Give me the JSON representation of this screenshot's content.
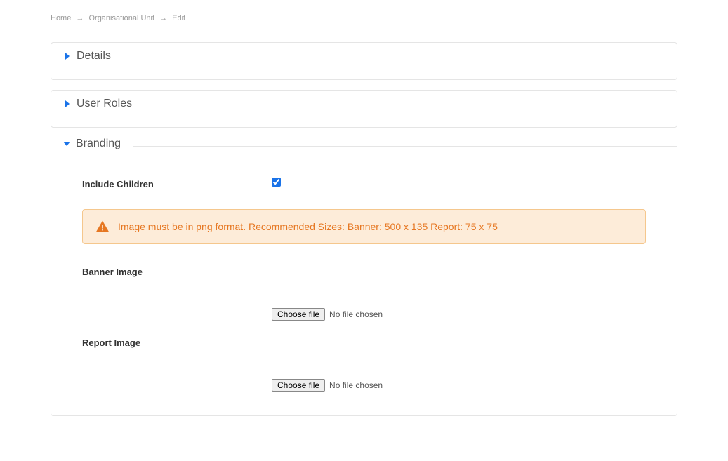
{
  "breadcrumb": {
    "items": [
      {
        "label": "Home"
      },
      {
        "label": "Organisational Unit"
      },
      {
        "label": "Edit"
      }
    ],
    "separator": "→"
  },
  "panels": {
    "details": {
      "title": "Details"
    },
    "userRoles": {
      "title": "User Roles"
    },
    "branding": {
      "title": "Branding"
    }
  },
  "branding": {
    "includeChildren": {
      "label": "Include Children",
      "checked": true
    },
    "alert": {
      "text": "Image must be in png format. Recommended Sizes: Banner: 500 x 135 Report: 75 x 75"
    },
    "bannerImage": {
      "label": "Banner Image",
      "button": "Choose file",
      "status": "No file chosen"
    },
    "reportImage": {
      "label": "Report Image",
      "button": "Choose file",
      "status": "No file chosen"
    }
  }
}
